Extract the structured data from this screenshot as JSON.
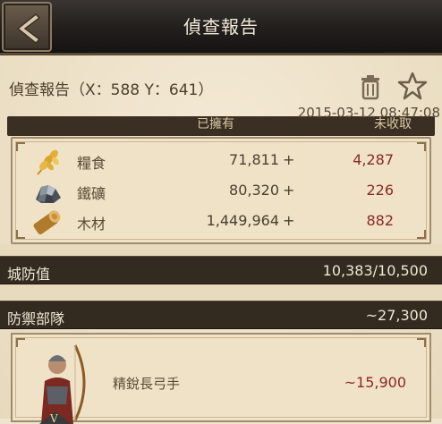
{
  "header": {
    "title": "偵查報告"
  },
  "report": {
    "title": "偵查報告（X：588 Y：641）",
    "timestamp": "2015-03-12  08:47:08"
  },
  "resources": {
    "col_owned": "已擁有",
    "col_uncollected": "未收取",
    "rows": [
      {
        "icon": "wheat-icon",
        "name": "糧食",
        "owned": "71,811",
        "plus": "+",
        "uncollected": "4,287"
      },
      {
        "icon": "iron-ore-icon",
        "name": "鐵礦",
        "owned": "80,320",
        "plus": "+",
        "uncollected": "226"
      },
      {
        "icon": "wood-log-icon",
        "name": "木材",
        "owned": "1,449,964",
        "plus": "+",
        "uncollected": "882"
      }
    ]
  },
  "city_defense": {
    "label": "城防值",
    "value": "10,383/10,500"
  },
  "defense_troops": {
    "label": "防禦部隊",
    "value": "~27,300"
  },
  "troops": [
    {
      "icon": "longbow-archer-icon",
      "badge": "V",
      "name": "精銳長弓手",
      "count": "~15,900"
    }
  ],
  "colors": {
    "header_bg": "#211e1c",
    "paper": "#efe4cd",
    "accent_red": "#8a2a23"
  }
}
